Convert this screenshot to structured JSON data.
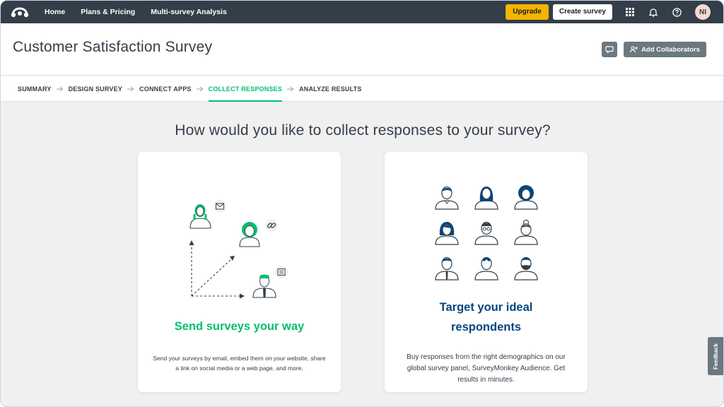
{
  "nav": {
    "home": "Home",
    "plans": "Plans & Pricing",
    "multi": "Multi-survey Analysis",
    "upgrade": "Upgrade",
    "create": "Create survey",
    "avatar_initials": "NI"
  },
  "header": {
    "title": "Customer Satisfaction Survey",
    "add_collaborators": "Add Collaborators"
  },
  "steps": [
    "SUMMARY",
    "DESIGN SURVEY",
    "CONNECT APPS",
    "COLLECT RESPONSES",
    "ANALYZE RESULTS"
  ],
  "active_step": "COLLECT RESPONSES",
  "main": {
    "heading": "How would you like to collect responses to your survey?",
    "cards": [
      {
        "title": "Send surveys your way",
        "description": "Send your surveys by email, embed them on your website, share a link on social media or a web page, and more."
      },
      {
        "title": "Target your ideal respondents",
        "description": "Buy responses from the right demographics on our global survey panel, SurveyMonkey Audience. Get results in minutes."
      }
    ]
  },
  "feedback": "Feedback",
  "colors": {
    "topbar": "#333e48",
    "accent_green": "#00bf6f",
    "accent_blue": "#05467e",
    "upgrade": "#f4b400",
    "button_gray": "#6b787f"
  },
  "icons": [
    "surveymonkey-logo",
    "apps-grid-icon",
    "bell-icon",
    "help-icon",
    "comment-icon",
    "add-user-icon",
    "arrow-right-icon"
  ]
}
